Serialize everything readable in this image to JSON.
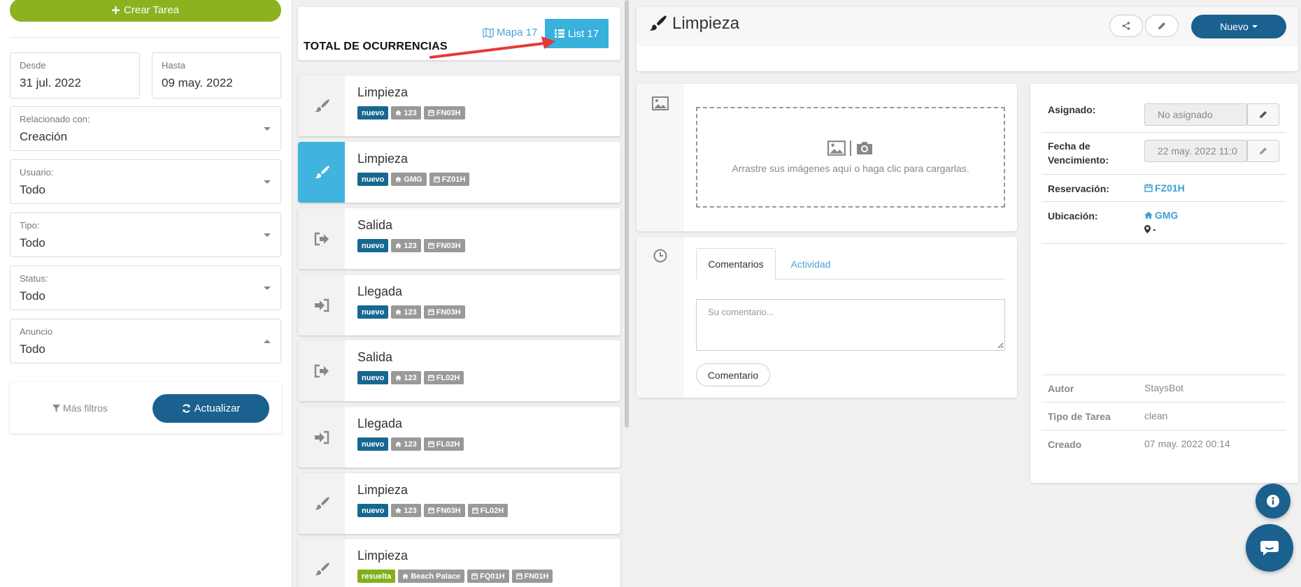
{
  "left": {
    "create_label": "Crear Tarea",
    "desde_label": "Desde",
    "desde_value": "31 jul. 2022",
    "hasta_label": "Hasta",
    "hasta_value": "09 may. 2022",
    "filters": [
      {
        "label": "Relacionado con:",
        "value": "Creación"
      },
      {
        "label": "Usuario:",
        "value": "Todo"
      },
      {
        "label": "Tipo:",
        "value": "Todo"
      },
      {
        "label": "Status:",
        "value": "Todo"
      },
      {
        "label": "Anuncio",
        "value": "Todo"
      }
    ],
    "more_filters": "Más filtros",
    "update_label": "Actualizar"
  },
  "list": {
    "total_label": "TOTAL DE OCURRENCIAS",
    "mapa_label": "Mapa 17",
    "list_label": "List 17",
    "items": [
      {
        "title": "Limpieza",
        "icon": "brush-icon",
        "tags": [
          {
            "t": "nuevo",
            "k": "nuevo"
          },
          {
            "t": "123",
            "k": "home"
          },
          {
            "t": "FN03H",
            "k": "cal"
          }
        ]
      },
      {
        "title": "Limpieza",
        "icon": "brush-icon",
        "tags": [
          {
            "t": "nuevo",
            "k": "nuevo"
          },
          {
            "t": "GMG",
            "k": "home"
          },
          {
            "t": "FZ01H",
            "k": "cal"
          }
        ]
      },
      {
        "title": "Salida",
        "icon": "sign-out-icon",
        "tags": [
          {
            "t": "nuevo",
            "k": "nuevo"
          },
          {
            "t": "123",
            "k": "home"
          },
          {
            "t": "FN03H",
            "k": "cal"
          }
        ]
      },
      {
        "title": "Llegada",
        "icon": "sign-in-icon",
        "tags": [
          {
            "t": "nuevo",
            "k": "nuevo"
          },
          {
            "t": "123",
            "k": "home"
          },
          {
            "t": "FN03H",
            "k": "cal"
          }
        ]
      },
      {
        "title": "Salida",
        "icon": "sign-out-icon",
        "tags": [
          {
            "t": "nuevo",
            "k": "nuevo"
          },
          {
            "t": "123",
            "k": "home"
          },
          {
            "t": "FL02H",
            "k": "cal"
          }
        ]
      },
      {
        "title": "Llegada",
        "icon": "sign-in-icon",
        "tags": [
          {
            "t": "nuevo",
            "k": "nuevo"
          },
          {
            "t": "123",
            "k": "home"
          },
          {
            "t": "FL02H",
            "k": "cal"
          }
        ]
      },
      {
        "title": "Limpieza",
        "icon": "brush-icon",
        "tags": [
          {
            "t": "nuevo",
            "k": "nuevo"
          },
          {
            "t": "123",
            "k": "home"
          },
          {
            "t": "FN03H",
            "k": "cal"
          },
          {
            "t": "FL02H",
            "k": "cal"
          }
        ]
      },
      {
        "title": "Limpieza",
        "icon": "brush-icon",
        "tags": [
          {
            "t": "resuelta",
            "k": "resuelta"
          },
          {
            "t": "Beach Palace",
            "k": "home"
          },
          {
            "t": "FQ01H",
            "k": "cal"
          },
          {
            "t": "FN01H",
            "k": "cal"
          }
        ]
      }
    ]
  },
  "detail": {
    "title": "Limpieza",
    "nuevo_label": "Nuevo",
    "dropzone_text": "Arrastre sus imágenes aquí o haga clic para cargarlas.",
    "tab_comments": "Comentarios",
    "tab_activity": "Actividad",
    "comment_placeholder": "Su comentario...",
    "comment_button": "Comentario",
    "asignado_label": "Asignado:",
    "asignado_value": "No asignado",
    "fecha_label_1": "Fecha de",
    "fecha_label_2": "Vencimiento:",
    "fecha_value": "22 may. 2022 11:0",
    "reservacion_label": "Reservación:",
    "reservacion_value": "FZ01H",
    "ubicacion_label": "Ubicación:",
    "ubicacion_value": "GMG",
    "ubicacion_sub": "-",
    "autor_label": "Autor",
    "autor_value": "StaysBot",
    "tipo_label": "Tipo de Tarea",
    "tipo_value": "clean",
    "creado_label": "Creado",
    "creado_value": "07 may. 2022 00:14"
  },
  "colors": {
    "primary": "#1a6190",
    "green": "#8cb21f",
    "accent": "#3ab0dc",
    "link": "#3aa0d6"
  }
}
